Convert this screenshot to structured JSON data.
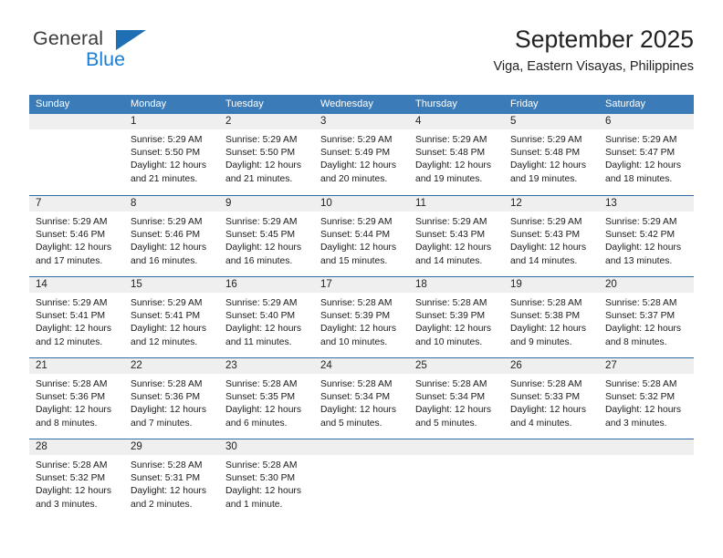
{
  "brand": {
    "name_part1": "General",
    "name_part2": "Blue",
    "triangle_color": "#1f6fb5",
    "blue_color": "#1a7fd4"
  },
  "header": {
    "title": "September 2025",
    "subtitle": "Viga, Eastern Visayas, Philippines"
  },
  "theme": {
    "header_bg": "#3b7cb8",
    "separator": "#2f6ca8",
    "day_band": "#efefef"
  },
  "weekdays": [
    "Sunday",
    "Monday",
    "Tuesday",
    "Wednesday",
    "Thursday",
    "Friday",
    "Saturday"
  ],
  "weeks": [
    [
      {
        "day": "",
        "sunrise": "",
        "sunset": "",
        "daylight1": "",
        "daylight2": ""
      },
      {
        "day": "1",
        "sunrise": "Sunrise: 5:29 AM",
        "sunset": "Sunset: 5:50 PM",
        "daylight1": "Daylight: 12 hours",
        "daylight2": "and 21 minutes."
      },
      {
        "day": "2",
        "sunrise": "Sunrise: 5:29 AM",
        "sunset": "Sunset: 5:50 PM",
        "daylight1": "Daylight: 12 hours",
        "daylight2": "and 21 minutes."
      },
      {
        "day": "3",
        "sunrise": "Sunrise: 5:29 AM",
        "sunset": "Sunset: 5:49 PM",
        "daylight1": "Daylight: 12 hours",
        "daylight2": "and 20 minutes."
      },
      {
        "day": "4",
        "sunrise": "Sunrise: 5:29 AM",
        "sunset": "Sunset: 5:48 PM",
        "daylight1": "Daylight: 12 hours",
        "daylight2": "and 19 minutes."
      },
      {
        "day": "5",
        "sunrise": "Sunrise: 5:29 AM",
        "sunset": "Sunset: 5:48 PM",
        "daylight1": "Daylight: 12 hours",
        "daylight2": "and 19 minutes."
      },
      {
        "day": "6",
        "sunrise": "Sunrise: 5:29 AM",
        "sunset": "Sunset: 5:47 PM",
        "daylight1": "Daylight: 12 hours",
        "daylight2": "and 18 minutes."
      }
    ],
    [
      {
        "day": "7",
        "sunrise": "Sunrise: 5:29 AM",
        "sunset": "Sunset: 5:46 PM",
        "daylight1": "Daylight: 12 hours",
        "daylight2": "and 17 minutes."
      },
      {
        "day": "8",
        "sunrise": "Sunrise: 5:29 AM",
        "sunset": "Sunset: 5:46 PM",
        "daylight1": "Daylight: 12 hours",
        "daylight2": "and 16 minutes."
      },
      {
        "day": "9",
        "sunrise": "Sunrise: 5:29 AM",
        "sunset": "Sunset: 5:45 PM",
        "daylight1": "Daylight: 12 hours",
        "daylight2": "and 16 minutes."
      },
      {
        "day": "10",
        "sunrise": "Sunrise: 5:29 AM",
        "sunset": "Sunset: 5:44 PM",
        "daylight1": "Daylight: 12 hours",
        "daylight2": "and 15 minutes."
      },
      {
        "day": "11",
        "sunrise": "Sunrise: 5:29 AM",
        "sunset": "Sunset: 5:43 PM",
        "daylight1": "Daylight: 12 hours",
        "daylight2": "and 14 minutes."
      },
      {
        "day": "12",
        "sunrise": "Sunrise: 5:29 AM",
        "sunset": "Sunset: 5:43 PM",
        "daylight1": "Daylight: 12 hours",
        "daylight2": "and 14 minutes."
      },
      {
        "day": "13",
        "sunrise": "Sunrise: 5:29 AM",
        "sunset": "Sunset: 5:42 PM",
        "daylight1": "Daylight: 12 hours",
        "daylight2": "and 13 minutes."
      }
    ],
    [
      {
        "day": "14",
        "sunrise": "Sunrise: 5:29 AM",
        "sunset": "Sunset: 5:41 PM",
        "daylight1": "Daylight: 12 hours",
        "daylight2": "and 12 minutes."
      },
      {
        "day": "15",
        "sunrise": "Sunrise: 5:29 AM",
        "sunset": "Sunset: 5:41 PM",
        "daylight1": "Daylight: 12 hours",
        "daylight2": "and 12 minutes."
      },
      {
        "day": "16",
        "sunrise": "Sunrise: 5:29 AM",
        "sunset": "Sunset: 5:40 PM",
        "daylight1": "Daylight: 12 hours",
        "daylight2": "and 11 minutes."
      },
      {
        "day": "17",
        "sunrise": "Sunrise: 5:28 AM",
        "sunset": "Sunset: 5:39 PM",
        "daylight1": "Daylight: 12 hours",
        "daylight2": "and 10 minutes."
      },
      {
        "day": "18",
        "sunrise": "Sunrise: 5:28 AM",
        "sunset": "Sunset: 5:39 PM",
        "daylight1": "Daylight: 12 hours",
        "daylight2": "and 10 minutes."
      },
      {
        "day": "19",
        "sunrise": "Sunrise: 5:28 AM",
        "sunset": "Sunset: 5:38 PM",
        "daylight1": "Daylight: 12 hours",
        "daylight2": "and 9 minutes."
      },
      {
        "day": "20",
        "sunrise": "Sunrise: 5:28 AM",
        "sunset": "Sunset: 5:37 PM",
        "daylight1": "Daylight: 12 hours",
        "daylight2": "and 8 minutes."
      }
    ],
    [
      {
        "day": "21",
        "sunrise": "Sunrise: 5:28 AM",
        "sunset": "Sunset: 5:36 PM",
        "daylight1": "Daylight: 12 hours",
        "daylight2": "and 8 minutes."
      },
      {
        "day": "22",
        "sunrise": "Sunrise: 5:28 AM",
        "sunset": "Sunset: 5:36 PM",
        "daylight1": "Daylight: 12 hours",
        "daylight2": "and 7 minutes."
      },
      {
        "day": "23",
        "sunrise": "Sunrise: 5:28 AM",
        "sunset": "Sunset: 5:35 PM",
        "daylight1": "Daylight: 12 hours",
        "daylight2": "and 6 minutes."
      },
      {
        "day": "24",
        "sunrise": "Sunrise: 5:28 AM",
        "sunset": "Sunset: 5:34 PM",
        "daylight1": "Daylight: 12 hours",
        "daylight2": "and 5 minutes."
      },
      {
        "day": "25",
        "sunrise": "Sunrise: 5:28 AM",
        "sunset": "Sunset: 5:34 PM",
        "daylight1": "Daylight: 12 hours",
        "daylight2": "and 5 minutes."
      },
      {
        "day": "26",
        "sunrise": "Sunrise: 5:28 AM",
        "sunset": "Sunset: 5:33 PM",
        "daylight1": "Daylight: 12 hours",
        "daylight2": "and 4 minutes."
      },
      {
        "day": "27",
        "sunrise": "Sunrise: 5:28 AM",
        "sunset": "Sunset: 5:32 PM",
        "daylight1": "Daylight: 12 hours",
        "daylight2": "and 3 minutes."
      }
    ],
    [
      {
        "day": "28",
        "sunrise": "Sunrise: 5:28 AM",
        "sunset": "Sunset: 5:32 PM",
        "daylight1": "Daylight: 12 hours",
        "daylight2": "and 3 minutes."
      },
      {
        "day": "29",
        "sunrise": "Sunrise: 5:28 AM",
        "sunset": "Sunset: 5:31 PM",
        "daylight1": "Daylight: 12 hours",
        "daylight2": "and 2 minutes."
      },
      {
        "day": "30",
        "sunrise": "Sunrise: 5:28 AM",
        "sunset": "Sunset: 5:30 PM",
        "daylight1": "Daylight: 12 hours",
        "daylight2": "and 1 minute."
      },
      {
        "day": "",
        "sunrise": "",
        "sunset": "",
        "daylight1": "",
        "daylight2": ""
      },
      {
        "day": "",
        "sunrise": "",
        "sunset": "",
        "daylight1": "",
        "daylight2": ""
      },
      {
        "day": "",
        "sunrise": "",
        "sunset": "",
        "daylight1": "",
        "daylight2": ""
      },
      {
        "day": "",
        "sunrise": "",
        "sunset": "",
        "daylight1": "",
        "daylight2": ""
      }
    ]
  ]
}
